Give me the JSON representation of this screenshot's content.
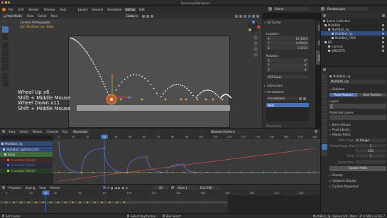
{
  "window": {
    "title": "Bouncing Ball.blend"
  },
  "menu": [
    "File",
    "Edit",
    "Render",
    "Window",
    "Help"
  ],
  "workspaces": [
    "Layout",
    "General",
    "Animation",
    "Extras",
    "Edit"
  ],
  "scene": {
    "name": "Scene",
    "view_layer": "RenderLayer"
  },
  "viewport": {
    "mode": "Pose Mode",
    "menus": [
      "View",
      "Select",
      "Pose"
    ],
    "orientation": "Global",
    "camera_label": "Camera Orthographic",
    "object_label": "(32) MultiBall_rig : Body",
    "overlay_lines": [
      "Wheel Up x6",
      "Shift + Middle Mouse",
      "Wheel Down x11",
      "Shift + Middle Mouse"
    ]
  },
  "sidebar": {
    "header": "3D Cursor",
    "location_label": "Location:",
    "rotation_label": "Rotation:",
    "mode_label": "XYZ Euler",
    "axes": [
      {
        "axis": "X",
        "loc": "16.3894",
        "rot": "0°"
      },
      {
        "axis": "Y",
        "loc": "0.00002",
        "rot": "0°"
      },
      {
        "axis": "Z",
        "loc": "1.0226",
        "rot": "0°"
      }
    ],
    "collections": "Collections",
    "annotations": "Annotations",
    "annot_btn": "Annotations",
    "note_label": "Note",
    "placement_label": "Placement",
    "tabs": [
      "Item",
      "Tool",
      "View"
    ]
  },
  "outliner": {
    "header": "Scene Collection",
    "items": [
      {
        "name": "MultiBall",
        "indent": 0
      },
      {
        "name": "MultiBall_rig",
        "indent": 1
      },
      {
        "name": "MultiBall_rig",
        "indent": 2
      },
      {
        "name": "MultiBall_FREE",
        "indent": 2
      },
      {
        "name": "BG",
        "indent": 0
      },
      {
        "name": "Camera",
        "indent": 1
      },
      {
        "name": "WIDGETS",
        "indent": 1
      }
    ]
  },
  "properties": {
    "object": "MultiBall_rig",
    "name_field": "MultiBall_rig",
    "skeleton": "Skeleton",
    "pose_position": "Pose Position",
    "rest_position": "Rest Position",
    "layers": "Layers",
    "protected_layers": "Protected Layers",
    "sections": [
      "Bone Groups",
      "Pose Library",
      "Motion Paths"
    ],
    "paths_type_label": "Paths Type",
    "paths_type": "In Range",
    "frame_range_label": "Frame Range Start",
    "frame_start": "1",
    "frame_end": "250",
    "step_label": "Step",
    "step": "1",
    "cache_label": "Cache from",
    "update_btn": "Update Paths",
    "display": "Display",
    "viewport_display": "Viewport Display",
    "custom_props": "Custom Properties"
  },
  "graph": {
    "menus": [
      "View",
      "Select",
      "Marker",
      "Channel",
      "Key"
    ],
    "normalize": "Normalize",
    "pivot": "Nearest Frame",
    "current_frame": "32",
    "channels": [
      {
        "name": "MultiBall_rig",
        "kind": "object"
      },
      {
        "name": "MultiBall_rigAction.003",
        "kind": "action"
      },
      {
        "name": "Body",
        "kind": "group"
      },
      {
        "name": "X Location (Body)",
        "kind": "x"
      },
      {
        "name": "Z Location (Body)",
        "kind": "z"
      },
      {
        "name": "Y Location (Body)",
        "kind": "y"
      }
    ],
    "ruler": [
      "0",
      "10",
      "20",
      "32",
      "40",
      "50",
      "60",
      "70",
      "80",
      "90",
      "100",
      "110",
      "120",
      "130",
      "140",
      "150",
      "160",
      "170",
      "180"
    ]
  },
  "timeline": {
    "menus": [
      "Playback",
      "Keying",
      "View",
      "Marker"
    ],
    "frame": "32",
    "start_label": "Start",
    "start": "1",
    "end_label": "End",
    "end": "180",
    "ruler": [
      "0",
      "20",
      "40",
      "60",
      "80",
      "100",
      "120",
      "140",
      "160",
      "180",
      "200",
      "220",
      "240"
    ]
  },
  "statusbar": {
    "left": "Set Cursor",
    "middle": "Select Keyframes",
    "middle2": "Box Select",
    "right": "MultiBall_rig | Bones:1/8 | Mem: 37.6 MiB | v2.82.7"
  },
  "colors": {
    "accent": "#4772b3",
    "curve_x": "#e8564a",
    "curve_z": "#4a6ee8",
    "curve_y": "#8fd14f",
    "keyframe": "#f0a030",
    "playhead": "#4772b3"
  }
}
